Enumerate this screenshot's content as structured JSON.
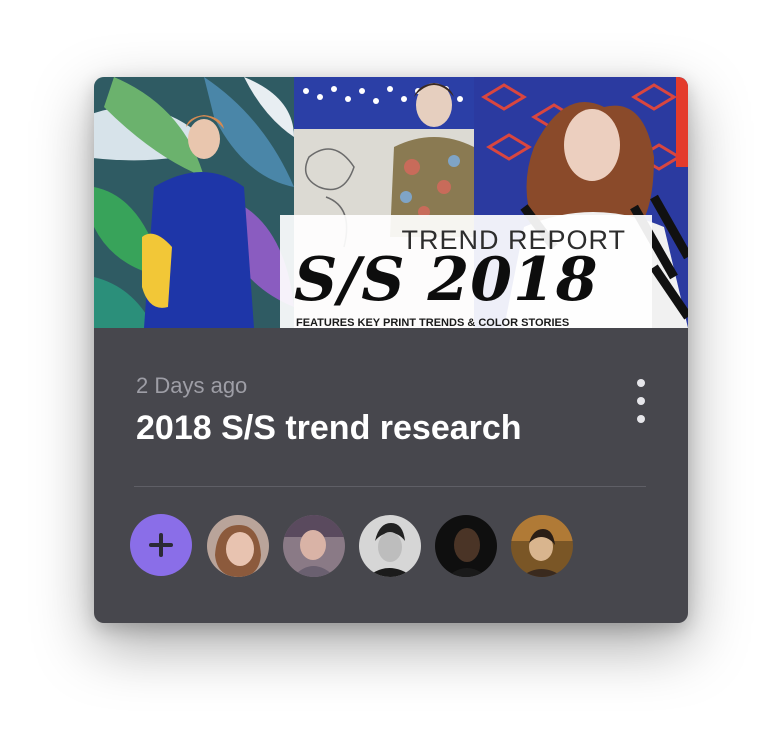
{
  "card": {
    "cover": {
      "kicker": "TREND REPORT",
      "headline": "S/S 2018",
      "subline": "FEATURES KEY PRINT TRENDS & COLOR STORIES"
    },
    "time_ago": "2 Days ago",
    "title": "2018 S/S trend research",
    "menu_icon": "more-vertical-icon",
    "add_icon": "plus-icon",
    "avatars": [
      {
        "name": "collaborator-1"
      },
      {
        "name": "collaborator-2"
      },
      {
        "name": "collaborator-3"
      },
      {
        "name": "collaborator-4"
      },
      {
        "name": "collaborator-5"
      }
    ]
  },
  "colors": {
    "card_bg": "#47474d",
    "accent": "#8a6ee8",
    "title_text": "#ffffff",
    "muted_text": "#9e9ea6"
  }
}
